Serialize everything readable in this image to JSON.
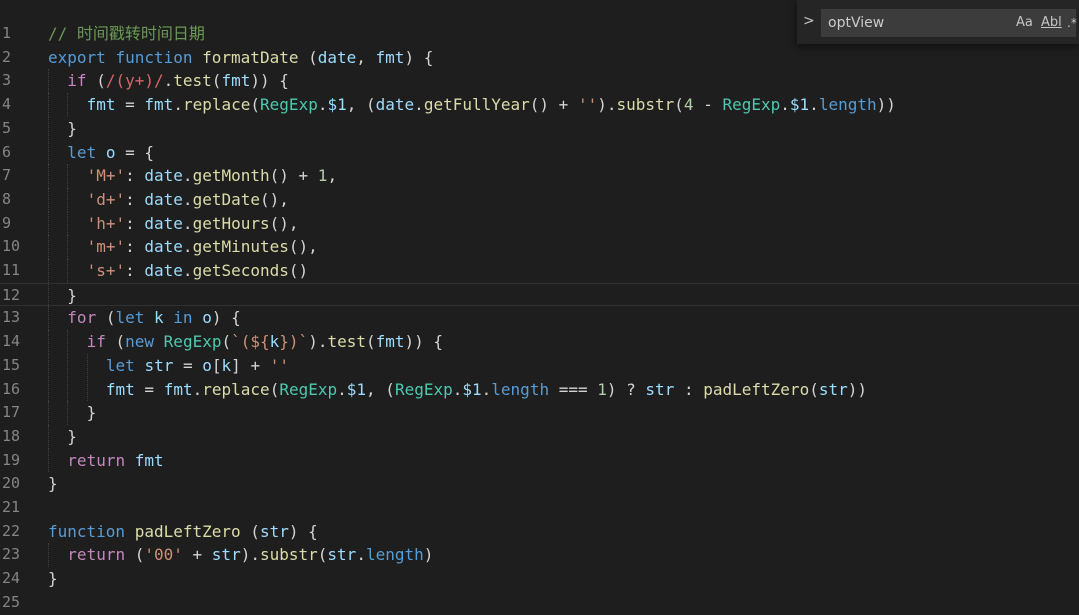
{
  "editor": {
    "lines": [
      {
        "n": "1",
        "indent": 0,
        "t": [
          [
            "cm",
            "// 时间戳转时间日期"
          ]
        ]
      },
      {
        "n": "2",
        "indent": 0,
        "t": [
          [
            "kw",
            "export"
          ],
          [
            "pl",
            " "
          ],
          [
            "kw",
            "function"
          ],
          [
            "pl",
            " "
          ],
          [
            "fn",
            "formatDate"
          ],
          [
            "pl",
            " ("
          ],
          [
            "var",
            "date"
          ],
          [
            "pl",
            ", "
          ],
          [
            "var",
            "fmt"
          ],
          [
            "pl",
            ") {"
          ]
        ]
      },
      {
        "n": "3",
        "indent": 1,
        "t": [
          [
            "ctrl",
            "if"
          ],
          [
            "pl",
            " ("
          ],
          [
            "re",
            "/(y+)/"
          ],
          [
            "pl",
            "."
          ],
          [
            "fn",
            "test"
          ],
          [
            "pl",
            "("
          ],
          [
            "var",
            "fmt"
          ],
          [
            "pl",
            ")) {"
          ]
        ]
      },
      {
        "n": "4",
        "indent": 2,
        "t": [
          [
            "var",
            "fmt"
          ],
          [
            "pl",
            " = "
          ],
          [
            "var",
            "fmt"
          ],
          [
            "pl",
            "."
          ],
          [
            "fn",
            "replace"
          ],
          [
            "pl",
            "("
          ],
          [
            "cls",
            "RegExp"
          ],
          [
            "pl",
            "."
          ],
          [
            "var",
            "$1"
          ],
          [
            "pl",
            ", ("
          ],
          [
            "var",
            "date"
          ],
          [
            "pl",
            "."
          ],
          [
            "fn",
            "getFullYear"
          ],
          [
            "pl",
            "() + "
          ],
          [
            "str",
            "''"
          ],
          [
            "pl",
            ")."
          ],
          [
            "fn",
            "substr"
          ],
          [
            "pl",
            "("
          ],
          [
            "num",
            "4"
          ],
          [
            "pl",
            " - "
          ],
          [
            "cls",
            "RegExp"
          ],
          [
            "pl",
            "."
          ],
          [
            "var",
            "$1"
          ],
          [
            "pl",
            "."
          ],
          [
            "kw",
            "length"
          ],
          [
            "pl",
            "))"
          ]
        ]
      },
      {
        "n": "5",
        "indent": 1,
        "t": [
          [
            "pl",
            "}"
          ]
        ]
      },
      {
        "n": "6",
        "indent": 1,
        "t": [
          [
            "kw",
            "let"
          ],
          [
            "pl",
            " "
          ],
          [
            "var",
            "o"
          ],
          [
            "pl",
            " = {"
          ]
        ]
      },
      {
        "n": "7",
        "indent": 2,
        "t": [
          [
            "str",
            "'M+'"
          ],
          [
            "pl",
            ": "
          ],
          [
            "var",
            "date"
          ],
          [
            "pl",
            "."
          ],
          [
            "fn",
            "getMonth"
          ],
          [
            "pl",
            "() + "
          ],
          [
            "num",
            "1"
          ],
          [
            "pl",
            ","
          ]
        ]
      },
      {
        "n": "8",
        "indent": 2,
        "t": [
          [
            "str",
            "'d+'"
          ],
          [
            "pl",
            ": "
          ],
          [
            "var",
            "date"
          ],
          [
            "pl",
            "."
          ],
          [
            "fn",
            "getDate"
          ],
          [
            "pl",
            "(),"
          ]
        ]
      },
      {
        "n": "9",
        "indent": 2,
        "t": [
          [
            "str",
            "'h+'"
          ],
          [
            "pl",
            ": "
          ],
          [
            "var",
            "date"
          ],
          [
            "pl",
            "."
          ],
          [
            "fn",
            "getHours"
          ],
          [
            "pl",
            "(),"
          ]
        ]
      },
      {
        "n": "10",
        "indent": 2,
        "t": [
          [
            "str",
            "'m+'"
          ],
          [
            "pl",
            ": "
          ],
          [
            "var",
            "date"
          ],
          [
            "pl",
            "."
          ],
          [
            "fn",
            "getMinutes"
          ],
          [
            "pl",
            "(),"
          ]
        ]
      },
      {
        "n": "11",
        "indent": 2,
        "t": [
          [
            "str",
            "'s+'"
          ],
          [
            "pl",
            ": "
          ],
          [
            "var",
            "date"
          ],
          [
            "pl",
            "."
          ],
          [
            "fn",
            "getSeconds"
          ],
          [
            "pl",
            "()"
          ]
        ]
      },
      {
        "n": "12",
        "indent": 1,
        "current": true,
        "t": [
          [
            "pl",
            "}"
          ]
        ]
      },
      {
        "n": "13",
        "indent": 1,
        "t": [
          [
            "ctrl",
            "for"
          ],
          [
            "pl",
            " ("
          ],
          [
            "kw",
            "let"
          ],
          [
            "pl",
            " "
          ],
          [
            "var",
            "k"
          ],
          [
            "pl",
            " "
          ],
          [
            "kw",
            "in"
          ],
          [
            "pl",
            " "
          ],
          [
            "var",
            "o"
          ],
          [
            "pl",
            ") {"
          ]
        ]
      },
      {
        "n": "14",
        "indent": 2,
        "t": [
          [
            "ctrl",
            "if"
          ],
          [
            "pl",
            " ("
          ],
          [
            "kw",
            "new"
          ],
          [
            "pl",
            " "
          ],
          [
            "cls",
            "RegExp"
          ],
          [
            "pl",
            "("
          ],
          [
            "str",
            "`(${"
          ],
          [
            "var",
            "k"
          ],
          [
            "str",
            "})`"
          ],
          [
            "pl",
            ")."
          ],
          [
            "fn",
            "test"
          ],
          [
            "pl",
            "("
          ],
          [
            "var",
            "fmt"
          ],
          [
            "pl",
            ")) {"
          ]
        ]
      },
      {
        "n": "15",
        "indent": 3,
        "t": [
          [
            "kw",
            "let"
          ],
          [
            "pl",
            " "
          ],
          [
            "var",
            "str"
          ],
          [
            "pl",
            " = "
          ],
          [
            "var",
            "o"
          ],
          [
            "pl",
            "["
          ],
          [
            "var",
            "k"
          ],
          [
            "pl",
            "] + "
          ],
          [
            "str",
            "''"
          ]
        ]
      },
      {
        "n": "16",
        "indent": 3,
        "t": [
          [
            "var",
            "fmt"
          ],
          [
            "pl",
            " = "
          ],
          [
            "var",
            "fmt"
          ],
          [
            "pl",
            "."
          ],
          [
            "fn",
            "replace"
          ],
          [
            "pl",
            "("
          ],
          [
            "cls",
            "RegExp"
          ],
          [
            "pl",
            "."
          ],
          [
            "var",
            "$1"
          ],
          [
            "pl",
            ", ("
          ],
          [
            "cls",
            "RegExp"
          ],
          [
            "pl",
            "."
          ],
          [
            "var",
            "$1"
          ],
          [
            "pl",
            "."
          ],
          [
            "kw",
            "length"
          ],
          [
            "pl",
            " === "
          ],
          [
            "num",
            "1"
          ],
          [
            "pl",
            ") ? "
          ],
          [
            "var",
            "str"
          ],
          [
            "pl",
            " : "
          ],
          [
            "fn",
            "padLeftZero"
          ],
          [
            "pl",
            "("
          ],
          [
            "var",
            "str"
          ],
          [
            "pl",
            "))"
          ]
        ]
      },
      {
        "n": "17",
        "indent": 2,
        "t": [
          [
            "pl",
            "}"
          ]
        ]
      },
      {
        "n": "18",
        "indent": 1,
        "t": [
          [
            "pl",
            "}"
          ]
        ]
      },
      {
        "n": "19",
        "indent": 1,
        "t": [
          [
            "ctrl",
            "return"
          ],
          [
            "pl",
            " "
          ],
          [
            "var",
            "fmt"
          ]
        ]
      },
      {
        "n": "20",
        "indent": 0,
        "t": [
          [
            "pl",
            "}"
          ]
        ]
      },
      {
        "n": "21",
        "indent": 0,
        "t": []
      },
      {
        "n": "22",
        "indent": 0,
        "t": [
          [
            "kw",
            "function"
          ],
          [
            "pl",
            " "
          ],
          [
            "fn",
            "padLeftZero"
          ],
          [
            "pl",
            " ("
          ],
          [
            "var",
            "str"
          ],
          [
            "pl",
            ") {"
          ]
        ]
      },
      {
        "n": "23",
        "indent": 1,
        "t": [
          [
            "ctrl",
            "return"
          ],
          [
            "pl",
            " ("
          ],
          [
            "str",
            "'00'"
          ],
          [
            "pl",
            " + "
          ],
          [
            "var",
            "str"
          ],
          [
            "pl",
            ")."
          ],
          [
            "fn",
            "substr"
          ],
          [
            "pl",
            "("
          ],
          [
            "var",
            "str"
          ],
          [
            "pl",
            "."
          ],
          [
            "kw",
            "length"
          ],
          [
            "pl",
            ")"
          ]
        ]
      },
      {
        "n": "24",
        "indent": 0,
        "t": [
          [
            "pl",
            "}"
          ]
        ]
      },
      {
        "n": "25",
        "indent": 0,
        "t": []
      }
    ]
  },
  "find": {
    "toggle_icon": "chevron-right-icon",
    "toggle_glyph": ">",
    "query": "optView",
    "match_case_label": "Aa",
    "whole_word_label": "Abl",
    "regex_label": ".*"
  }
}
